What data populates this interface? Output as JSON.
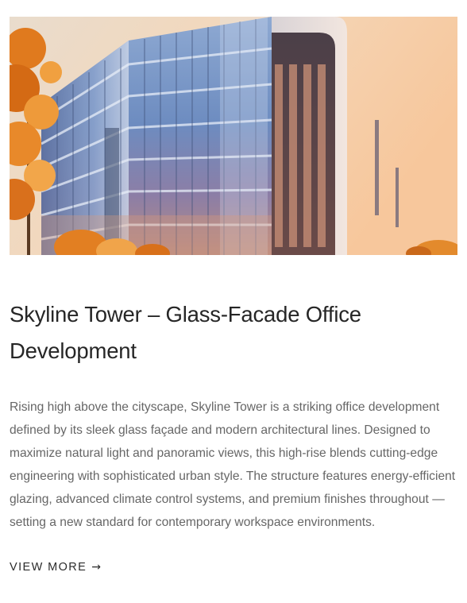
{
  "post": {
    "image_subject": "building-photo",
    "title": "Skyline Tower – Glass-Facade Office Development",
    "excerpt": "Rising high above the cityscape, Skyline Tower is a striking office development defined by its sleek glass façade and modern architectural lines. Designed to maximize natural light and panoramic views, this high-rise blends cutting-edge engineering with sophisticated urban style. The structure features energy-efficient glazing, advanced climate control systems, and premium finishes throughout — setting a new standard for contemporary workspace environments.",
    "more_label": "VIEW MORE",
    "more_arrow": "→"
  },
  "colors": {
    "sky_warm": "#f6d5b4",
    "glass_blue": "#6f8fbf",
    "foliage_orange": "#e07a1e",
    "text_dark": "#262626",
    "text_muted": "#666666"
  }
}
